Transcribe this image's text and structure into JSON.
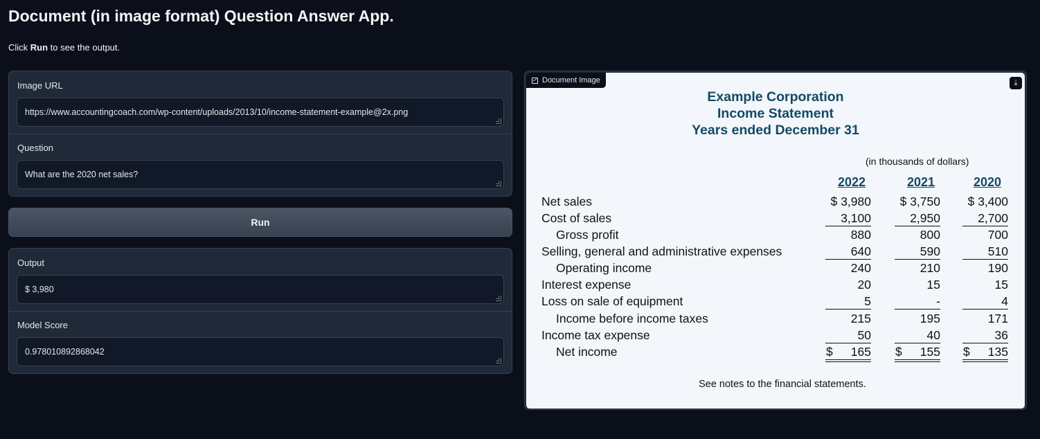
{
  "app": {
    "title": "Document (in image format) Question Answer App.",
    "description_prefix": "Click ",
    "description_bold": "Run",
    "description_suffix": " to see the output."
  },
  "inputs": {
    "image_url_label": "Image URL",
    "image_url_value": "https://www.accountingcoach.com/wp-content/uploads/2013/10/income-statement-example@2x.png",
    "question_label": "Question",
    "question_value": "What are the 2020 net sales?"
  },
  "run_button_label": "Run",
  "outputs": {
    "output_label": "Output",
    "output_value": "$ 3,980",
    "score_label": "Model Score",
    "score_value": "0.978010892868042"
  },
  "document_panel": {
    "badge_label": "Document Image",
    "image_icon": "image-icon",
    "download_icon": "download-icon"
  },
  "statement": {
    "company": "Example Corporation",
    "title": "Income Statement",
    "period": "Years ended December 31",
    "units": "(in thousands of dollars)",
    "years": [
      "2022",
      "2021",
      "2020"
    ],
    "rows": [
      {
        "label": "Net sales",
        "values": [
          "$ 3,980",
          "$ 3,750",
          "$ 3,400"
        ]
      },
      {
        "label": "Cost of sales",
        "values": [
          "3,100",
          "2,950",
          "2,700"
        ]
      },
      {
        "label": "Gross profit",
        "values": [
          "880",
          "800",
          "700"
        ]
      },
      {
        "label": "Selling, general and administrative expenses",
        "values": [
          "640",
          "590",
          "510"
        ]
      },
      {
        "label": "Operating income",
        "values": [
          "240",
          "210",
          "190"
        ]
      },
      {
        "label": "Interest expense",
        "values": [
          "20",
          "15",
          "15"
        ]
      },
      {
        "label": "Loss on sale of equipment",
        "values": [
          "5",
          "-",
          "4"
        ]
      },
      {
        "label": "Income before income taxes",
        "values": [
          "215",
          "195",
          "171"
        ]
      },
      {
        "label": "Income tax expense",
        "values": [
          "50",
          "40",
          "36"
        ]
      },
      {
        "label": "Net income",
        "values": [
          "165",
          "155",
          "135"
        ]
      }
    ],
    "currency_symbol": "$",
    "note": "See notes to the financial statements."
  }
}
